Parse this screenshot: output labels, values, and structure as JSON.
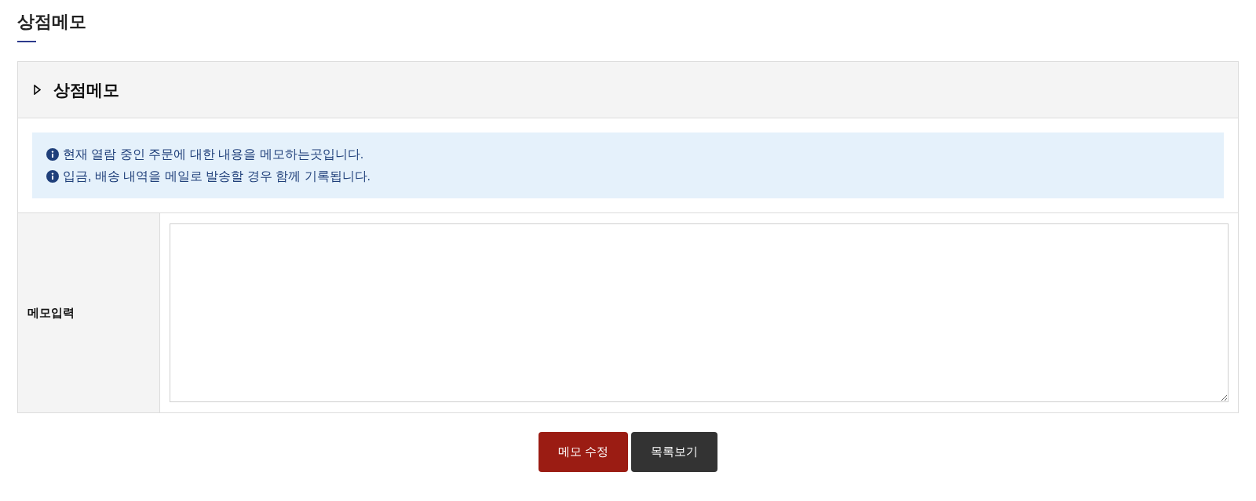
{
  "page_title": "상점메모",
  "panel": {
    "title": "상점메모",
    "notices": [
      "현재 열람 중인 주문에 대한 내용을 메모하는곳입니다.",
      "입금, 배송 내역을 메일로 발송할 경우 함께 기록됩니다."
    ],
    "field": {
      "label": "메모입력"
    }
  },
  "buttons": [
    {
      "label": "메모 수정",
      "kind": "primary"
    },
    {
      "label": "목록보기",
      "kind": "secondary"
    }
  ]
}
